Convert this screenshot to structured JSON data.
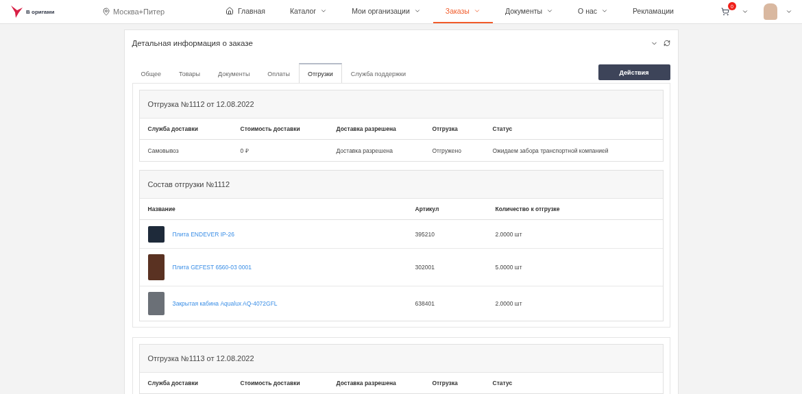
{
  "header": {
    "logo": "В оригами",
    "location": "Москва+Питер",
    "nav": [
      {
        "label": "Главная",
        "dropdown": false,
        "selected": false
      },
      {
        "label": "Каталог",
        "dropdown": true,
        "selected": false
      },
      {
        "label": "Мои организации",
        "dropdown": true,
        "selected": false
      },
      {
        "label": "Заказы",
        "dropdown": true,
        "selected": true
      },
      {
        "label": "Документы",
        "dropdown": true,
        "selected": false
      },
      {
        "label": "О нас",
        "dropdown": true,
        "selected": false
      },
      {
        "label": "Рекламации",
        "dropdown": false,
        "selected": false
      }
    ],
    "cart_count": "0"
  },
  "card": {
    "title": "Детальная информация о заказе",
    "tabs": [
      {
        "label": "Общее",
        "selected": false
      },
      {
        "label": "Товары",
        "selected": false
      },
      {
        "label": "Документы",
        "selected": false
      },
      {
        "label": "Оплаты",
        "selected": false
      },
      {
        "label": "Отгрузки",
        "selected": true
      },
      {
        "label": "Служба поддержки",
        "selected": false
      }
    ],
    "action_button": "Действия",
    "shipments": [
      {
        "title": "Отгрузка №1112 от 12.08.2022",
        "columns": [
          "Служба доставки",
          "Стоимость доставки",
          "Доставка разрешена",
          "Отгрузка",
          "Статус"
        ],
        "rows": [
          [
            "Самовывоз",
            "0 ₽",
            "Доставка разрешена",
            "Отгружено",
            "Ожидаем забора транспортной компанией"
          ]
        ],
        "composition": {
          "title": "Состав отгрузки №1112",
          "columns": [
            "Название",
            "Артикул",
            "Количество к отгрузке"
          ],
          "items": [
            {
              "name": "Плита ENDEVER IP-26",
              "article": "395210",
              "quantity": "2.0000 шт",
              "color": "#1e2a3a"
            },
            {
              "name": "Плита GEFEST 6560-03 0001",
              "article": "302001",
              "quantity": "5.0000 шт",
              "color": "#5a3222"
            },
            {
              "name": "Закрытая кабина Aqualux AQ-4072GFL",
              "article": "638401",
              "quantity": "2.0000 шт",
              "color": "#6b7077"
            }
          ]
        }
      },
      {
        "title": "Отгрузка №1113 от 12.08.2022",
        "columns": [
          "Служба доставки",
          "Стоимость доставки",
          "Доставка разрешена",
          "Отгрузка",
          "Статус"
        ]
      }
    ]
  }
}
